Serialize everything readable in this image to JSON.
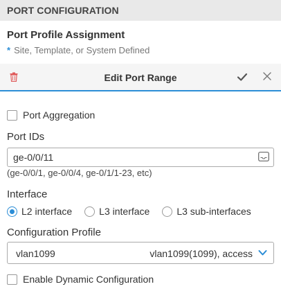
{
  "header": {
    "title": "PORT CONFIGURATION"
  },
  "profile": {
    "title": "Port Profile Assignment",
    "required_marker": "*",
    "subtitle": "Site, Template, or System Defined"
  },
  "edit_bar": {
    "title": "Edit Port Range",
    "accent_color": "#2b8dd6"
  },
  "port_aggregation": {
    "label": "Port Aggregation",
    "checked": false
  },
  "port_ids": {
    "label": "Port IDs",
    "value": "ge-0/0/11",
    "hint": "(ge-0/0/1, ge-0/0/4, ge-0/1/1-23, etc)"
  },
  "interface": {
    "label": "Interface",
    "options": [
      {
        "label": "L2 interface",
        "selected": true
      },
      {
        "label": "L3 interface",
        "selected": false
      },
      {
        "label": "L3 sub-interfaces",
        "selected": false
      }
    ]
  },
  "config_profile": {
    "label": "Configuration Profile",
    "value": "vlan1099",
    "description": "vlan1099(1099), access"
  },
  "dynamic_config": {
    "label": "Enable Dynamic Configuration",
    "checked": false
  },
  "icons": [
    "trash-icon",
    "check-icon",
    "close-icon",
    "list-icon",
    "chevron-down-icon"
  ]
}
